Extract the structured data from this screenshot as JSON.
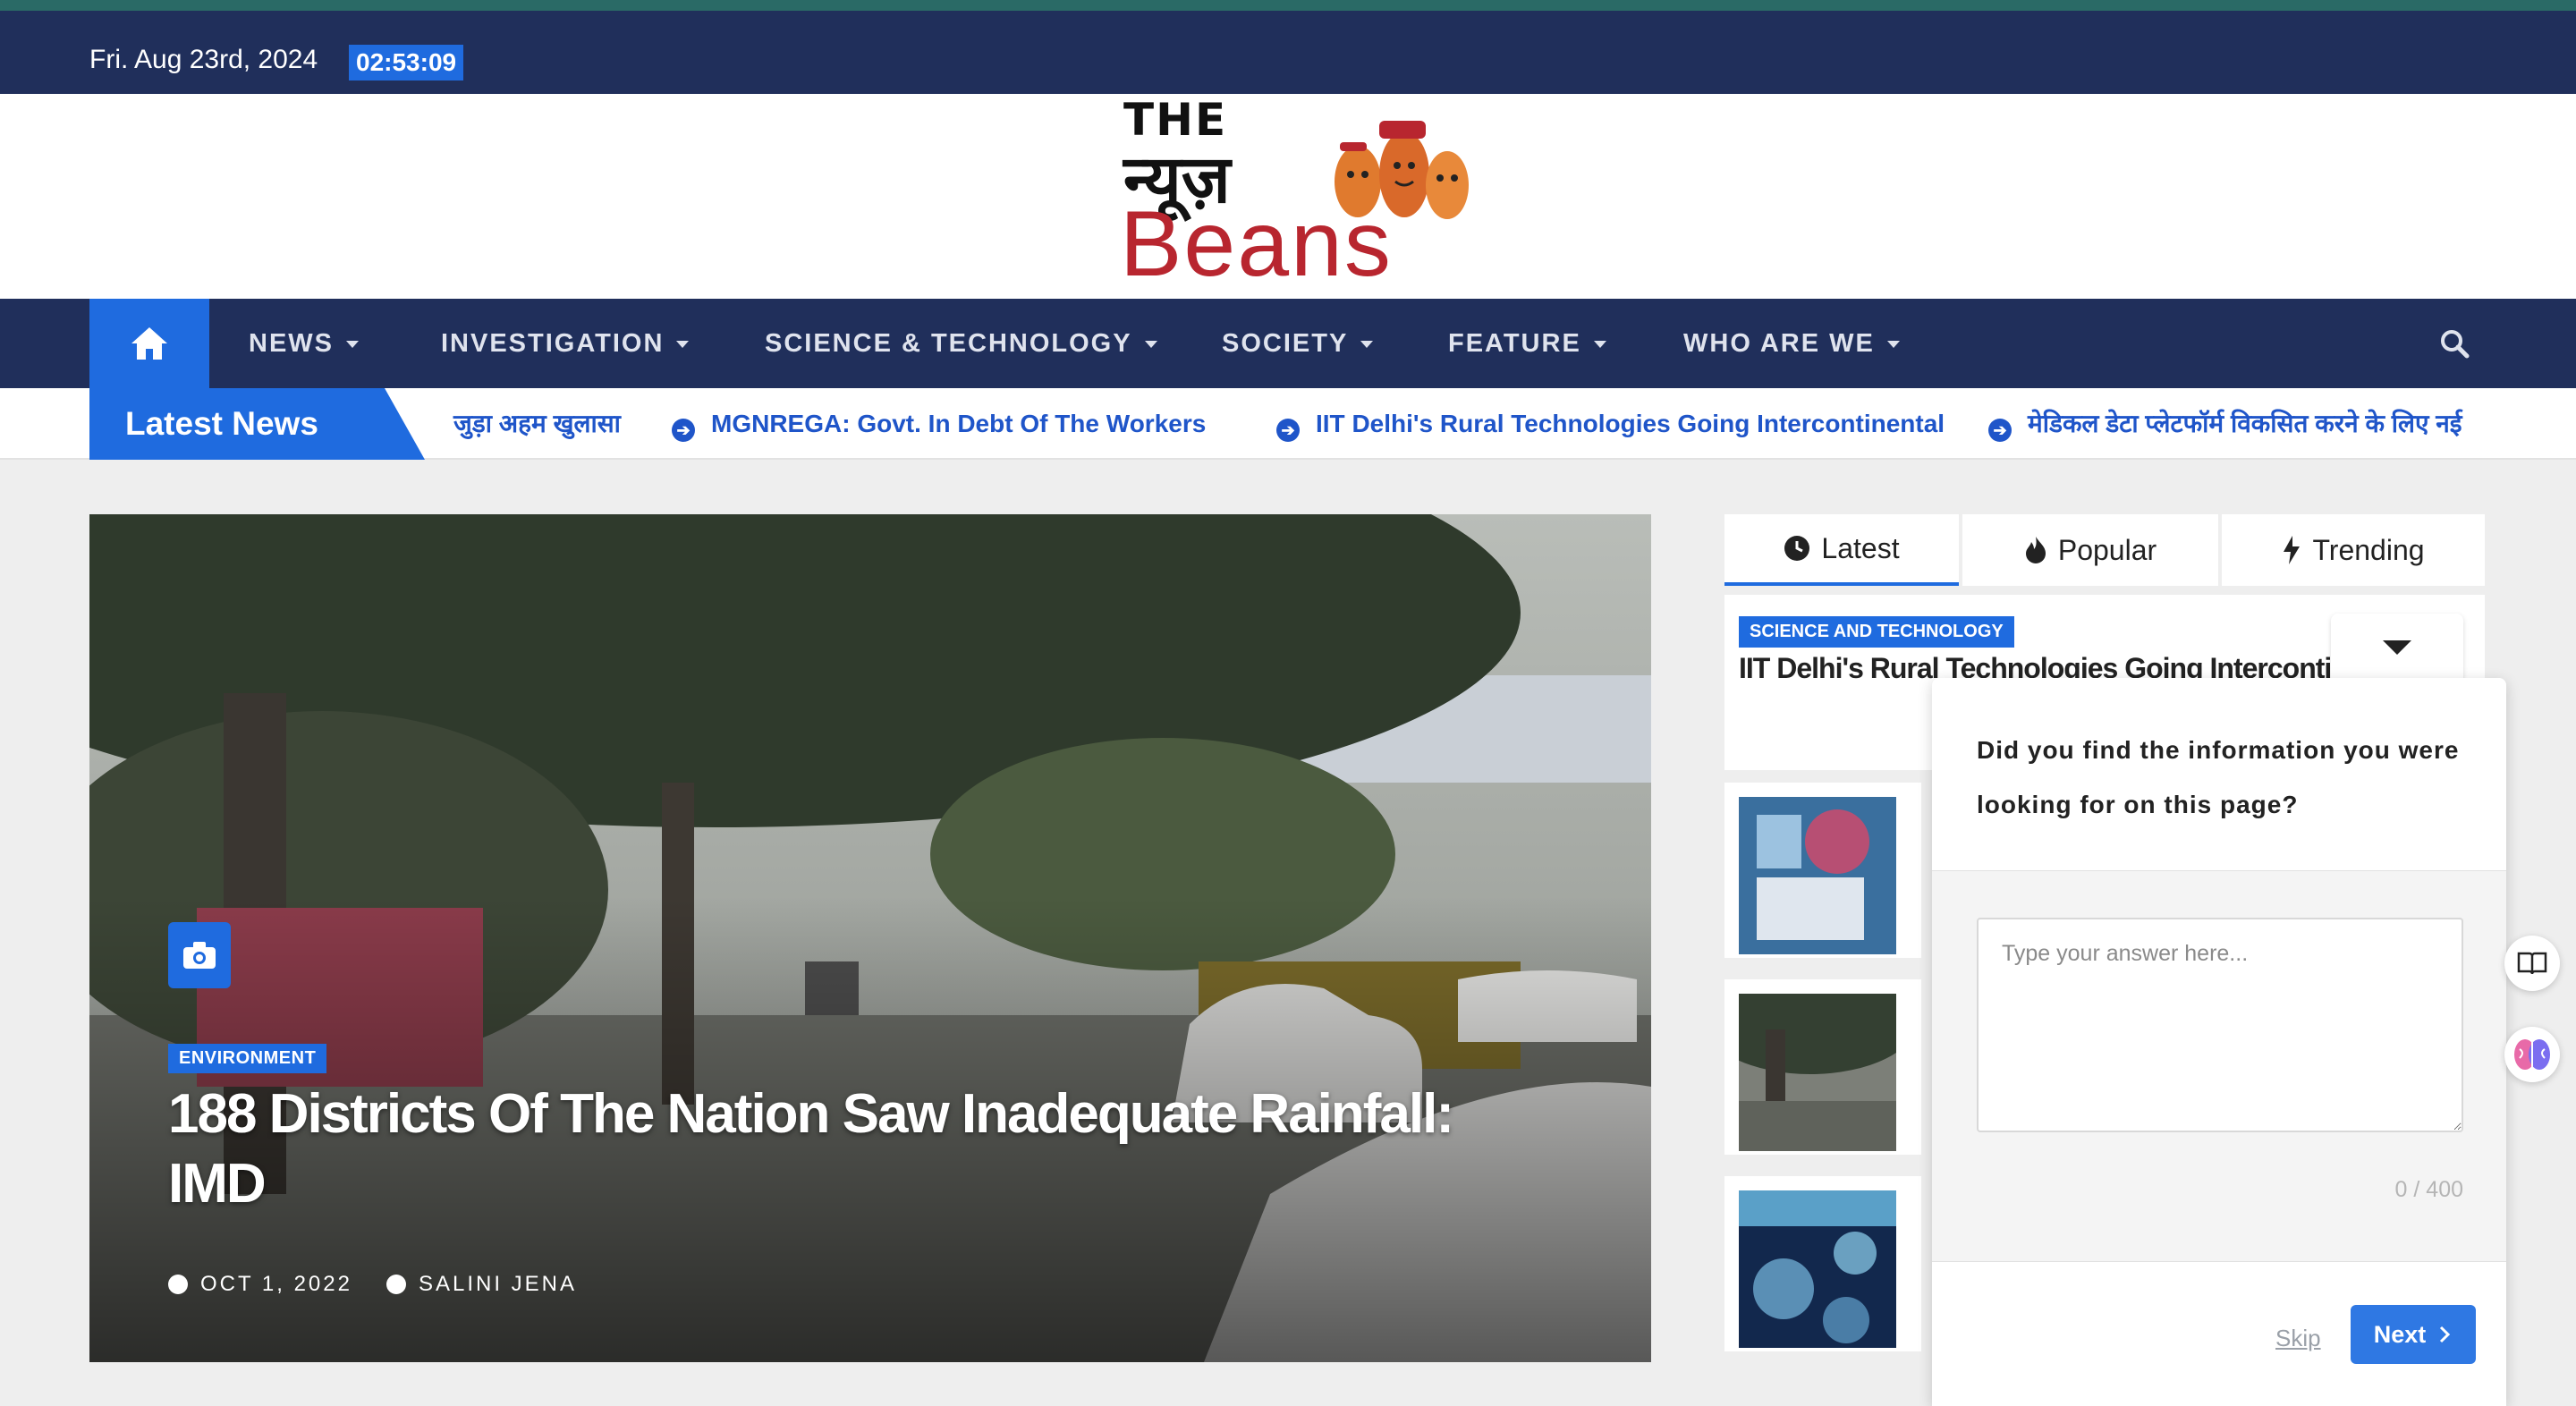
{
  "topbar": {
    "date": "Fri. Aug 23rd, 2024",
    "time": "02:53:09"
  },
  "logo": {
    "line1": "THE",
    "line2": "न्यूज़",
    "line3": "Beans"
  },
  "nav": {
    "home_icon": "home-icon",
    "items": [
      {
        "label": "NEWS"
      },
      {
        "label": "INVESTIGATION"
      },
      {
        "label": "SCIENCE & TECHNOLOGY"
      },
      {
        "label": "SOCIETY"
      },
      {
        "label": "FEATURE"
      },
      {
        "label": "WHO ARE WE"
      }
    ],
    "search_icon": "search-icon"
  },
  "ticker": {
    "label": "Latest News",
    "items": [
      "जुड़ा अहम खुलासा",
      "MGNREGA: Govt. In Debt Of The Workers",
      "IIT Delhi's Rural Technologies Going Intercontinental",
      "मेडिकल डेटा प्लेटफॉर्म विकसित करने के लिए नई"
    ]
  },
  "hero": {
    "category": "ENVIRONMENT",
    "title": "188 Districts Of The Nation Saw Inadequate Rainfall: IMD",
    "date": "OCT 1, 2022",
    "author": "SALINI JENA"
  },
  "sidebar": {
    "tabs": [
      {
        "label": "Latest",
        "icon": "clock-icon"
      },
      {
        "label": "Popular",
        "icon": "fire-icon"
      },
      {
        "label": "Trending",
        "icon": "bolt-icon"
      }
    ],
    "first_post": {
      "category": "SCIENCE AND TECHNOLOGY",
      "title": "IIT Delhi's Rural Technologies Going Intercontinental"
    }
  },
  "survey": {
    "question": "Did you find the information you were looking for on this page?",
    "placeholder": "Type your answer here...",
    "counter": "0 / 400",
    "skip": "Skip",
    "next": "Next"
  },
  "colors": {
    "navy": "#202f5b",
    "accent": "#1f6bdf",
    "brand_red": "#b8262f"
  }
}
